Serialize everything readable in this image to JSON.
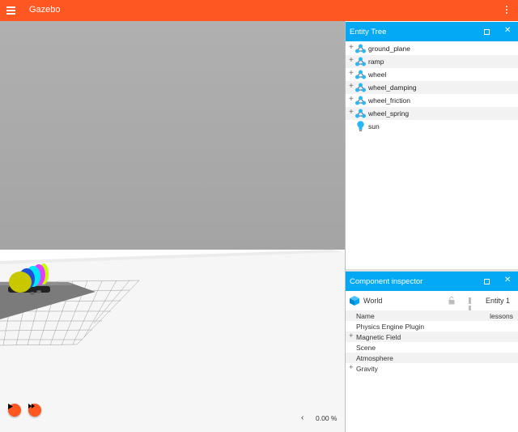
{
  "app": {
    "title": "Gazebo"
  },
  "colors": {
    "toolbar": "#ff5722",
    "panel_header": "#03a9f4"
  },
  "icons": {
    "menu": "hamburger-menu-icon",
    "options": "vertical-dots-icon",
    "model": "model-icon",
    "light": "light-bulb-icon"
  },
  "playback": {
    "real_time_factor": "0.00 %"
  },
  "entity_tree": {
    "title": "Entity Tree",
    "items": [
      {
        "label": "ground_plane",
        "type": "model",
        "expandable": true
      },
      {
        "label": "ramp",
        "type": "model",
        "expandable": true
      },
      {
        "label": "wheel",
        "type": "model",
        "expandable": true
      },
      {
        "label": "wheel_damping",
        "type": "model",
        "expandable": true
      },
      {
        "label": "wheel_friction",
        "type": "model",
        "expandable": true
      },
      {
        "label": "wheel_spring",
        "type": "model",
        "expandable": true
      },
      {
        "label": "sun",
        "type": "light",
        "expandable": false
      }
    ]
  },
  "inspector": {
    "title": "Component inspector",
    "entity_type": "World",
    "entity_id": "Entity 1",
    "properties": [
      {
        "label": "Name",
        "value": "lessons",
        "expandable": false
      },
      {
        "label": "Physics Engine Plugin",
        "value": "",
        "expandable": false
      },
      {
        "label": "Magnetic Field",
        "value": "",
        "expandable": true
      },
      {
        "label": "Scene",
        "value": "",
        "expandable": false
      },
      {
        "label": "Atmosphere",
        "value": "",
        "expandable": false
      },
      {
        "label": "Gravity",
        "value": "",
        "expandable": true
      }
    ]
  }
}
